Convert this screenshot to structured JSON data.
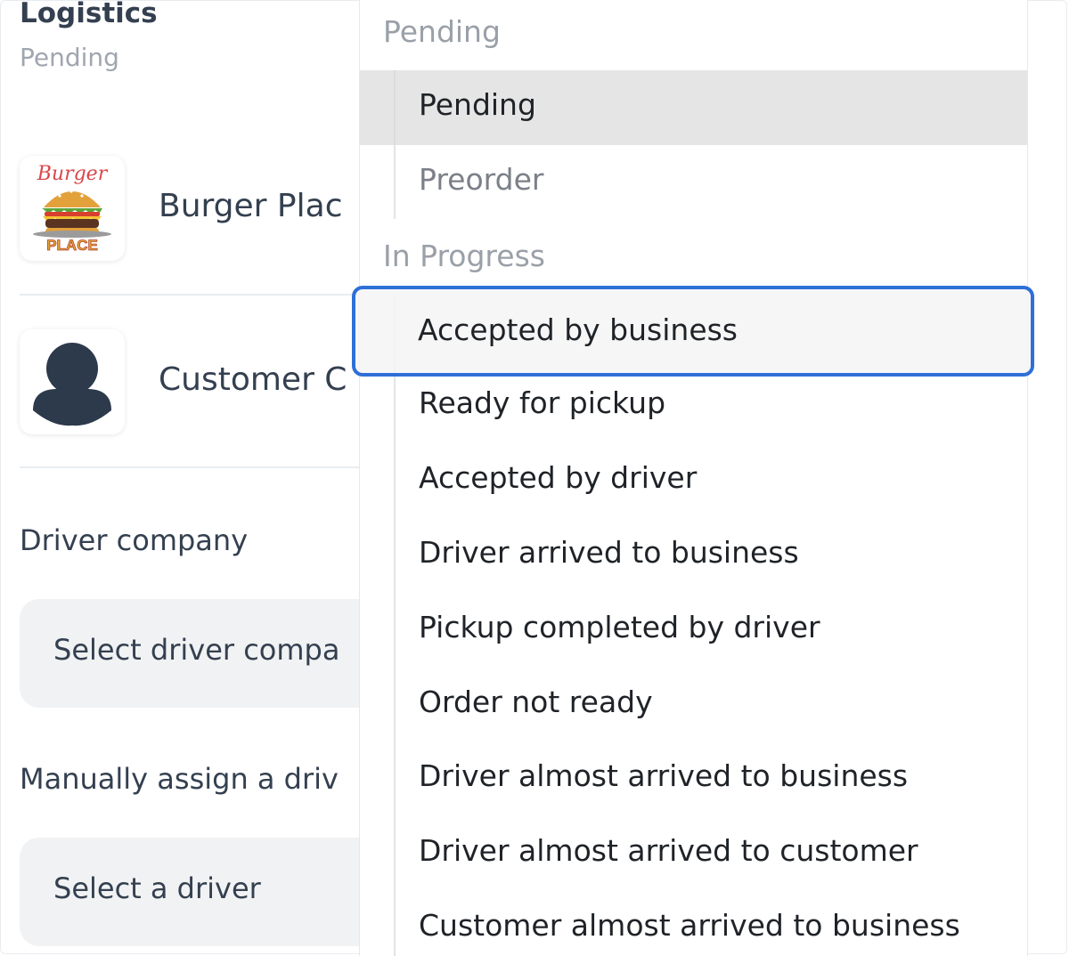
{
  "panel": {
    "title": "Logistics",
    "subtitle": "Pending",
    "business_name": "Burger Plac",
    "customer_name": "Customer C",
    "driver_company_label": "Driver company",
    "driver_company_placeholder": "Select driver compa",
    "manual_driver_label": "Manually assign a driv",
    "driver_placeholder": "Select a driver"
  },
  "logo": {
    "line1": "Burger",
    "line2": "PLACE"
  },
  "dropdown": {
    "current_value": "Pending",
    "groups": [
      {
        "label": "In Progress"
      }
    ],
    "pending_options": [
      "Pending",
      "Preorder"
    ],
    "in_progress_options": [
      "Accepted by business",
      "Ready for pickup",
      "Accepted by driver",
      "Driver arrived to business",
      "Pickup completed by driver",
      "Order not ready",
      "Driver almost arrived to business",
      "Driver almost arrived to customer",
      "Customer almost arrived to business"
    ]
  },
  "colors": {
    "focus": "#2e6fd8",
    "selected_bg": "#e5e5e5",
    "text": "#344050",
    "muted": "#9aa0a8"
  }
}
